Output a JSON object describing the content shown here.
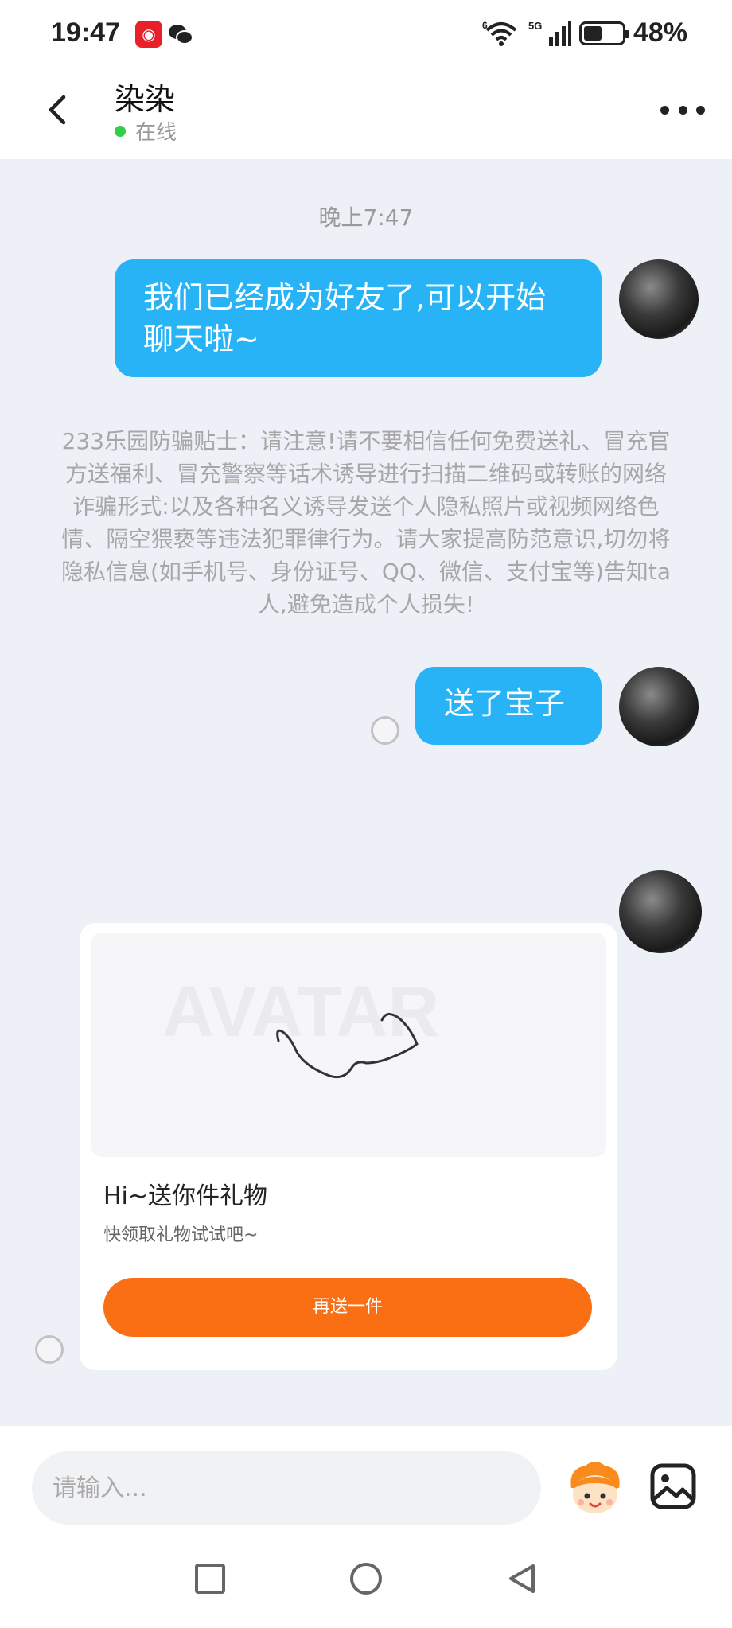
{
  "status_bar": {
    "time": "19:47",
    "network_label": "5G",
    "wifi_label": "6",
    "battery_percent": "48%",
    "battery_level": 0.48
  },
  "header": {
    "contact_name": "染染",
    "status": "在线",
    "online_color": "#2fcf4a"
  },
  "chat": {
    "timestamp": "晚上7:47",
    "messages": [
      {
        "side": "right",
        "text": "我们已经成为好友了,可以开始聊天啦~"
      },
      {
        "side": "right",
        "text": "送了宝子"
      }
    ],
    "safety_notice": "233乐园防骗贴士：请注意!请不要相信任何免费送礼、冒充官方送福利、冒充警察等话术诱导进行扫描二维码或转账的网络诈骗形式:以及各种名义诱导发送个人隐私照片或视频网络色情、隔空猥亵等违法犯罪律行为。请大家提高防范意识,切勿将隐私信息(如手机号、身份证号、QQ、微信、支付宝等)告知ta人,避免造成个人损失!",
    "gift_card": {
      "watermark_text": "AVATAR",
      "title": "Hi~送你件礼物",
      "subtitle": "快领取礼物试试吧~",
      "button_label": "再送一件"
    }
  },
  "input_bar": {
    "placeholder": "请输入..."
  },
  "colors": {
    "bubble": "#27b3f5",
    "gift_button": "#fb6f14",
    "background": "#eef0f7"
  },
  "icons": [
    "back-arrow-icon",
    "more-dots-icon",
    "emoji-mascot-icon",
    "image-picker-icon",
    "nav-recents-icon",
    "nav-home-icon",
    "nav-back-icon"
  ]
}
